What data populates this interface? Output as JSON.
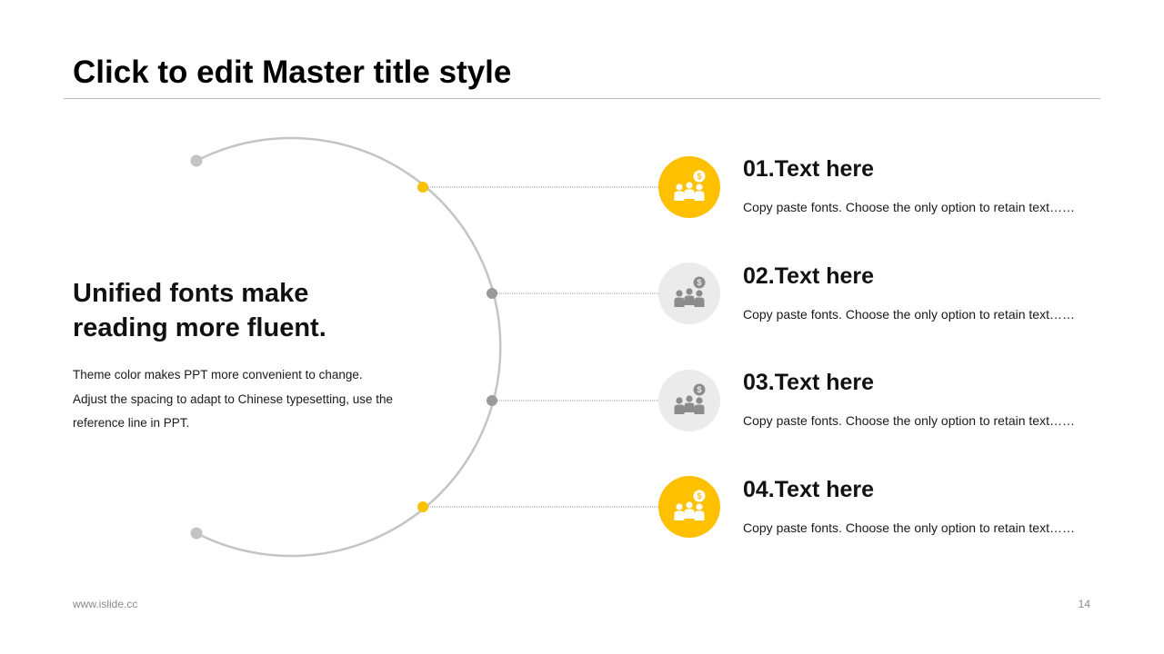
{
  "slide": {
    "title": "Click to edit Master title style",
    "headline": [
      "Unified fonts make",
      "reading more fluent."
    ],
    "body_lines": [
      "Theme color makes PPT more convenient to change.",
      "Adjust the spacing to adapt to Chinese typesetting, use the",
      "reference line in PPT."
    ],
    "footer": {
      "url": "www.islide.cc",
      "page_number": "14"
    }
  },
  "items": [
    {
      "heading": "01.Text here",
      "description": "Copy paste fonts. Choose the only option to retain text……",
      "highlighted": true,
      "icon": "people-money-icon"
    },
    {
      "heading": "02.Text here",
      "description": "Copy paste fonts. Choose the only option to retain text……",
      "highlighted": false,
      "icon": "people-money-icon"
    },
    {
      "heading": "03.Text here",
      "description": "Copy paste fonts. Choose the only option to retain text……",
      "highlighted": false,
      "icon": "people-money-icon"
    },
    {
      "heading": "04.Text here",
      "description": "Copy paste fonts. Choose the only option to retain text……",
      "highlighted": true,
      "icon": "people-money-icon"
    }
  ],
  "colors": {
    "accent": "#FFC000",
    "inactive_circle": "#EBEBEB",
    "inactive_icon": "#8C8C8C",
    "arc": "#C4C4C4",
    "connector": "#9A9A9A"
  }
}
